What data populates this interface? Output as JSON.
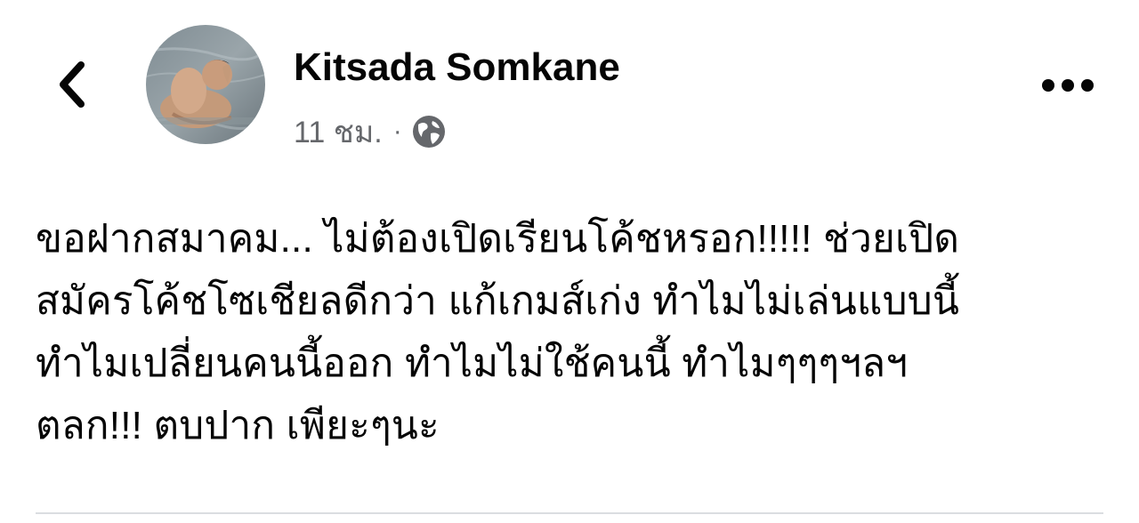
{
  "post": {
    "author_name": "Kitsada Somkane",
    "time": "11 ชม.",
    "separator": "·",
    "audience_icon": "globe-icon",
    "body": "ขอฝากสมาคม... ไม่ต้องเปิดเรียนโค้ชหรอก!!!!! ช่วยเปิด\nสมัครโค้ชโซเชียลดีกว่า แก้เกมส์เก่ง ทำไมไม่เล่นแบบนี้\nทำไมเปลี่ยนคนนี้ออก ทำไมไม่ใช้คนนี้ ทำไมๆๆๆฯลฯ\nตลก!!! ตบปาก เพียะๆนะ"
  },
  "icons": {
    "back": "chevron-left-icon",
    "more": "more-horizontal-icon"
  },
  "colors": {
    "text": "#050505",
    "secondary_text": "#65676b",
    "divider": "#dadde1"
  }
}
